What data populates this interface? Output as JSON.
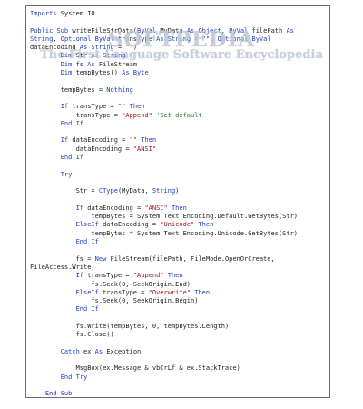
{
  "code_lines": [
    [
      {
        "t": "Imports ",
        "c": "kw"
      },
      {
        "t": "System.IO"
      }
    ],
    [],
    [
      {
        "t": "Public Sub ",
        "c": "kw"
      },
      {
        "t": "writeFileStrData("
      },
      {
        "t": "ByVal ",
        "c": "kw"
      },
      {
        "t": "MyData "
      },
      {
        "t": "As Object",
        "c": "kw"
      },
      {
        "t": ", "
      },
      {
        "t": "ByVal ",
        "c": "kw"
      },
      {
        "t": "filePath "
      },
      {
        "t": "As",
        "c": "kw"
      }
    ],
    [
      {
        "t": "String",
        "c": "kw"
      },
      {
        "t": ", "
      },
      {
        "t": "Optional ByVal ",
        "c": "kw"
      },
      {
        "t": "transType "
      },
      {
        "t": "As String ",
        "c": "kw"
      },
      {
        "t": "= "
      },
      {
        "t": "\"\"",
        "c": "str"
      },
      {
        "t": ", "
      },
      {
        "t": "Optional ByVal",
        "c": "kw"
      }
    ],
    [
      {
        "t": "dataEncoding "
      },
      {
        "t": "As String ",
        "c": "kw"
      },
      {
        "t": "= "
      },
      {
        "t": "\"\"",
        "c": "str"
      },
      {
        "t": ")"
      }
    ],
    [
      {
        "t": "        "
      },
      {
        "t": "Dim ",
        "c": "kw"
      },
      {
        "t": "Str "
      },
      {
        "t": "As String",
        "c": "kw"
      }
    ],
    [
      {
        "t": "        "
      },
      {
        "t": "Dim ",
        "c": "kw"
      },
      {
        "t": "fs "
      },
      {
        "t": "As ",
        "c": "kw"
      },
      {
        "t": "FileStream"
      }
    ],
    [
      {
        "t": "        "
      },
      {
        "t": "Dim ",
        "c": "kw"
      },
      {
        "t": "tempBytes() "
      },
      {
        "t": "As Byte",
        "c": "kw"
      }
    ],
    [],
    [
      {
        "t": "        tempBytes = "
      },
      {
        "t": "Nothing",
        "c": "kw"
      }
    ],
    [],
    [
      {
        "t": "        "
      },
      {
        "t": "If ",
        "c": "kw"
      },
      {
        "t": "transType = "
      },
      {
        "t": "\"\" ",
        "c": "str"
      },
      {
        "t": "Then",
        "c": "kw"
      }
    ],
    [
      {
        "t": "            transType = "
      },
      {
        "t": "\"Append\" ",
        "c": "str"
      },
      {
        "t": "'Set default",
        "c": "cmt"
      }
    ],
    [
      {
        "t": "        "
      },
      {
        "t": "End If",
        "c": "kw"
      }
    ],
    [],
    [
      {
        "t": "        "
      },
      {
        "t": "If ",
        "c": "kw"
      },
      {
        "t": "dataEncoding = "
      },
      {
        "t": "\"\" ",
        "c": "str"
      },
      {
        "t": "Then",
        "c": "kw"
      }
    ],
    [
      {
        "t": "            dataEncoding = "
      },
      {
        "t": "\"ANSI\"",
        "c": "str"
      }
    ],
    [
      {
        "t": "        "
      },
      {
        "t": "End If",
        "c": "kw"
      }
    ],
    [],
    [
      {
        "t": "        "
      },
      {
        "t": "Try",
        "c": "kw"
      }
    ],
    [],
    [
      {
        "t": "            Str = "
      },
      {
        "t": "CType",
        "c": "kw"
      },
      {
        "t": "(MyData, "
      },
      {
        "t": "String",
        "c": "kw"
      },
      {
        "t": ")"
      }
    ],
    [],
    [
      {
        "t": "            "
      },
      {
        "t": "If ",
        "c": "kw"
      },
      {
        "t": "dataEncoding = "
      },
      {
        "t": "\"ANSI\" ",
        "c": "str"
      },
      {
        "t": "Then",
        "c": "kw"
      }
    ],
    [
      {
        "t": "                tempBytes = System.Text.Encoding.Default.GetBytes(Str)"
      }
    ],
    [
      {
        "t": "            "
      },
      {
        "t": "ElseIf ",
        "c": "kw"
      },
      {
        "t": "dataEncoding = "
      },
      {
        "t": "\"Unicode\" ",
        "c": "str"
      },
      {
        "t": "Then",
        "c": "kw"
      }
    ],
    [
      {
        "t": "                tempBytes = System.Text.Encoding.Unicode.GetBytes(Str)"
      }
    ],
    [
      {
        "t": "            "
      },
      {
        "t": "End If",
        "c": "kw"
      }
    ],
    [],
    [
      {
        "t": "            fs = "
      },
      {
        "t": "New ",
        "c": "kw"
      },
      {
        "t": "FileStream(filePath, FileMode.OpenOrCreate,"
      }
    ],
    [
      {
        "t": "FileAccess.Write)"
      }
    ],
    [
      {
        "t": "            "
      },
      {
        "t": "If ",
        "c": "kw"
      },
      {
        "t": "transType = "
      },
      {
        "t": "\"Append\" ",
        "c": "str"
      },
      {
        "t": "Then",
        "c": "kw"
      }
    ],
    [
      {
        "t": "                fs.Seek(0, SeekOrigin.End)"
      }
    ],
    [
      {
        "t": "            "
      },
      {
        "t": "ElseIf ",
        "c": "kw"
      },
      {
        "t": "transType = "
      },
      {
        "t": "\"Overwrite\" ",
        "c": "str"
      },
      {
        "t": "Then",
        "c": "kw"
      }
    ],
    [
      {
        "t": "                fs.Seek(0, SeekOrigin.Begin)"
      }
    ],
    [
      {
        "t": "            "
      },
      {
        "t": "End If",
        "c": "kw"
      }
    ],
    [],
    [
      {
        "t": "            fs.Write(tempBytes, 0, tempBytes.Length)"
      }
    ],
    [
      {
        "t": "            fs.Close()"
      }
    ],
    [],
    [
      {
        "t": "        "
      },
      {
        "t": "Catch ",
        "c": "kw"
      },
      {
        "t": "ex "
      },
      {
        "t": "As ",
        "c": "kw"
      },
      {
        "t": "Exception"
      }
    ],
    [],
    [
      {
        "t": "            MsgBox(ex.Message & vbCrLf & ex.StackTrace)"
      }
    ],
    [
      {
        "t": "        "
      },
      {
        "t": "End Try",
        "c": "kw"
      }
    ],
    [],
    [
      {
        "t": "    "
      },
      {
        "t": "End Sub",
        "c": "kw"
      }
    ]
  ],
  "watermark": {
    "title": "SOFTPEDIA",
    "subtitle": "The First Language Software Encyclopedia"
  }
}
